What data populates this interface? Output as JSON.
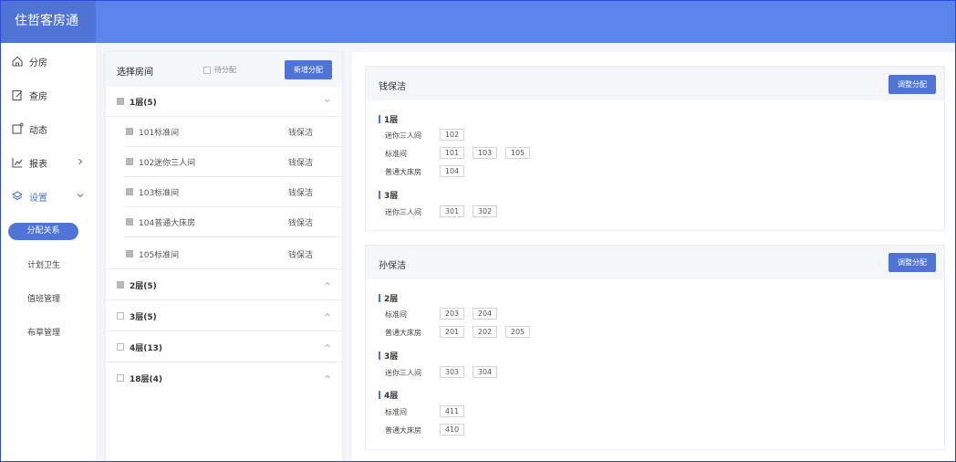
{
  "app": {
    "title": "住哲客房通"
  },
  "sidebar": {
    "items": [
      {
        "label": "分房",
        "icon": "home-icon"
      },
      {
        "label": "查房",
        "icon": "edit-icon"
      },
      {
        "label": "动态",
        "icon": "message-icon"
      },
      {
        "label": "报表",
        "icon": "chart-icon"
      },
      {
        "label": "设置",
        "icon": "layers-icon"
      }
    ],
    "sub_items": [
      {
        "label": "分配关系",
        "active": true
      },
      {
        "label": "计划卫生"
      },
      {
        "label": "值班管理"
      },
      {
        "label": "布草管理"
      }
    ]
  },
  "room_panel": {
    "title": "选择房间",
    "pending_label": "待分配",
    "add_button": "新增分配",
    "floors": [
      {
        "label": "1层(5)",
        "checked": true,
        "expanded": true
      },
      {
        "label": "2层(5)",
        "checked": true,
        "expanded": false
      },
      {
        "label": "3层(5)",
        "checked": false,
        "expanded": false
      },
      {
        "label": "4层(13)",
        "checked": false,
        "expanded": false
      },
      {
        "label": "18层(4)",
        "checked": false,
        "expanded": false
      }
    ],
    "rooms": [
      {
        "label": "101标准间",
        "cleaner": "钱保洁"
      },
      {
        "label": "102迷你三人间",
        "cleaner": "钱保洁"
      },
      {
        "label": "103标准间",
        "cleaner": "钱保洁"
      },
      {
        "label": "104普通大床房",
        "cleaner": "钱保洁"
      },
      {
        "label": "105标准间",
        "cleaner": "钱保洁"
      }
    ]
  },
  "assignments": {
    "adjust_button": "调整分配",
    "cards": [
      {
        "name": "钱保洁",
        "floors": [
          {
            "label": "1层",
            "types": [
              {
                "label": "迷你三人间",
                "rooms": [
                  "102"
                ]
              },
              {
                "label": "标准间",
                "rooms": [
                  "101",
                  "103",
                  "105"
                ]
              },
              {
                "label": "普通大床房",
                "rooms": [
                  "104"
                ]
              }
            ]
          },
          {
            "label": "3层",
            "types": [
              {
                "label": "迷你三人间",
                "rooms": [
                  "301",
                  "302"
                ]
              }
            ]
          }
        ]
      },
      {
        "name": "孙保洁",
        "floors": [
          {
            "label": "2层",
            "types": [
              {
                "label": "标准间",
                "rooms": [
                  "203",
                  "204"
                ]
              },
              {
                "label": "普通大床房",
                "rooms": [
                  "201",
                  "202",
                  "205"
                ]
              }
            ]
          },
          {
            "label": "3层",
            "types": [
              {
                "label": "迷你三人间",
                "rooms": [
                  "303",
                  "304"
                ]
              }
            ]
          },
          {
            "label": "4层",
            "types": [
              {
                "label": "标准间",
                "rooms": [
                  "411"
                ]
              },
              {
                "label": "普通大床房",
                "rooms": [
                  "410"
                ]
              }
            ]
          }
        ]
      }
    ]
  },
  "colors": {
    "accent": "#4f74d6",
    "header": "#5b85ea"
  }
}
